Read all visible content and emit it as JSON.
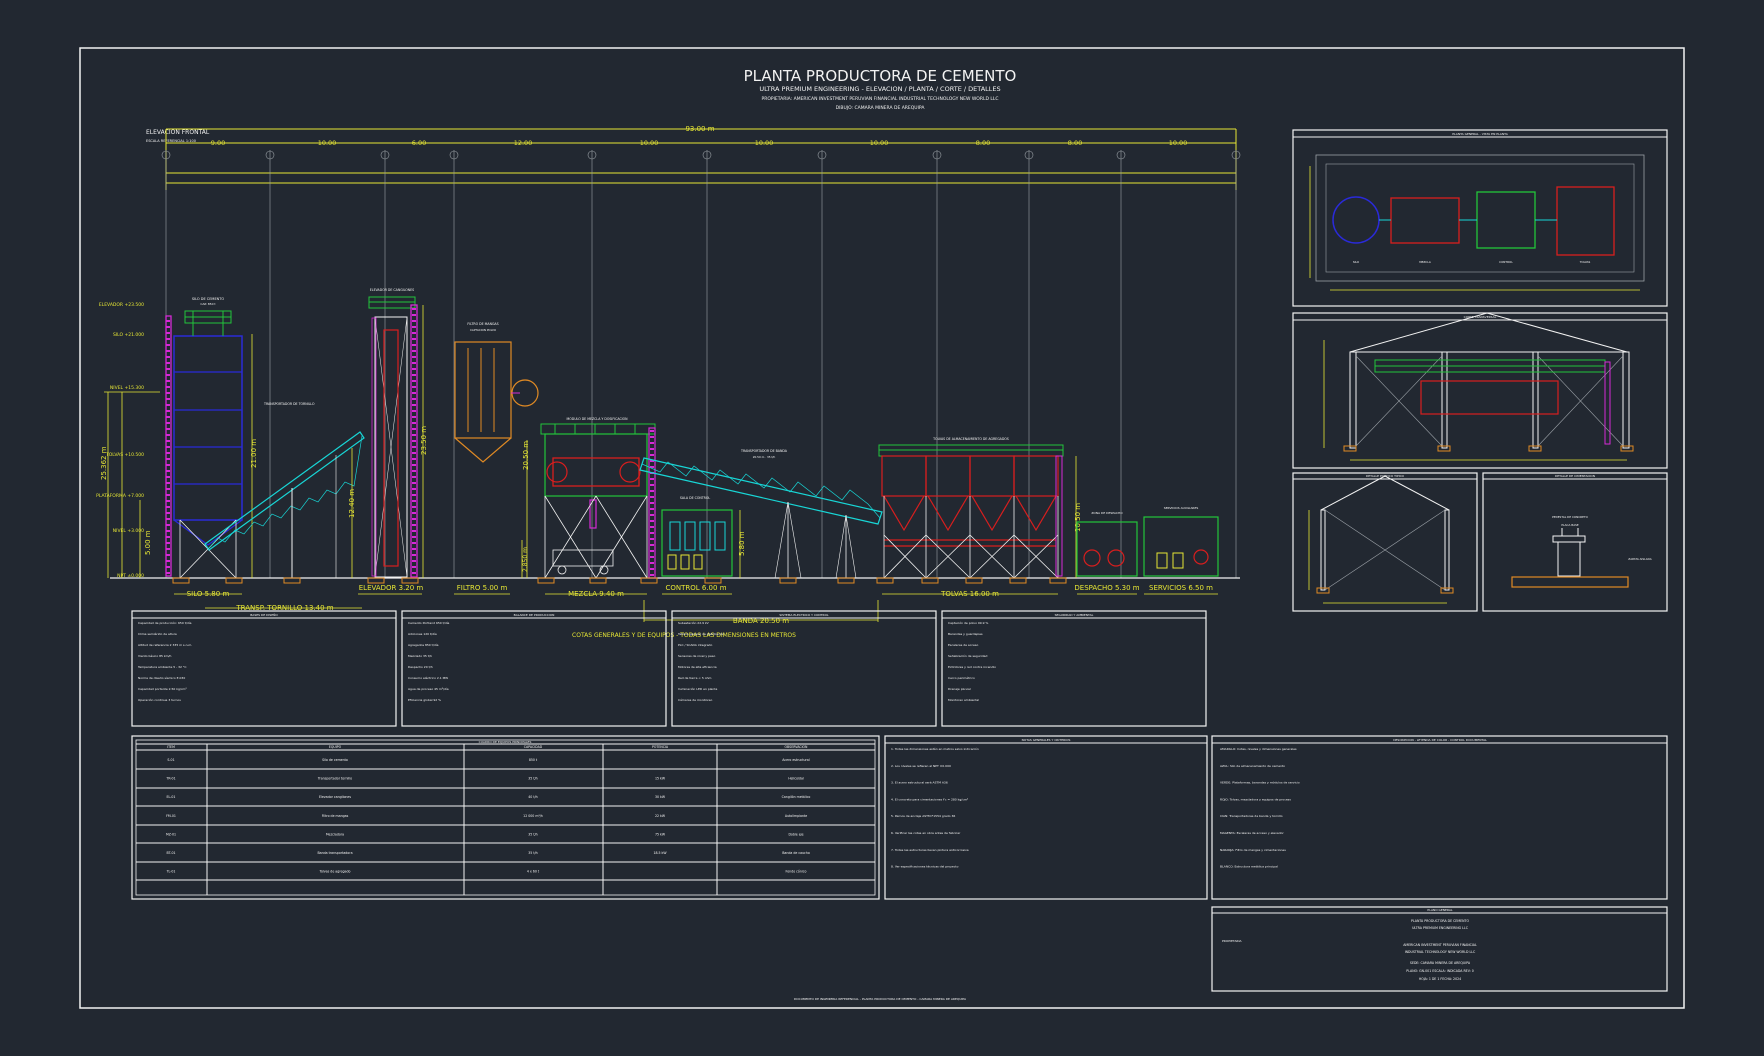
{
  "colors": {
    "bg": "#222831",
    "line": "#f2f2f2",
    "dim": "#e6e635",
    "blue": "#2a2ad8",
    "green": "#22c53a",
    "red": "#d81e1e",
    "cyan": "#18d6d6",
    "magenta": "#d62ad6",
    "orange": "#e08a24",
    "grey": "#9aa0a6"
  },
  "header": {
    "title": "PLANTA PRODUCTORA DE CEMENTO",
    "subtitle": "ULTRA PREMIUM ENGINEERING - ELEVACION / PLANTA / CORTE / DETALLES",
    "owner": "PROPIETARIA: AMERICAN INVESTMENT PERUVIAN FINANCIAL INDUSTRIAL TECHNOLOGY NEW WORLD LLC",
    "drawn": "DIBUJO: CAMARA MINERA DE AREQUIPA"
  },
  "elevation": {
    "label": "ELEVACION FRONTAL",
    "scale": "ESCALA REFERENCIAL 1:100",
    "total": "93.00 m",
    "spans": [
      "9.00",
      "10.00",
      "6.00",
      "12.00",
      "10.00",
      "10.00",
      "10.00",
      "8.00",
      "8.00",
      "10.00"
    ],
    "levels": [
      "ELEVADOR +23.500",
      "SILO +21.000",
      "NIVEL +15.300",
      "TOLVAS +10.500",
      "PLATAFORMA +7.000",
      "NIVEL +3.000",
      "NPT ±0.000"
    ],
    "vert_dims": {
      "silo": "21.00 m",
      "left_total": "25.362 m",
      "silo_base": "5.00 m",
      "tornillo": "12.40 m",
      "elevador": "23.50 m",
      "filtro": "20.50 m",
      "mezcla_base": "2.850 m",
      "control": "5.80 m",
      "tolvas": "10.50 m"
    },
    "callouts": {
      "silo": "SILO DE CEMENTO",
      "silo_cap": "CAP. 850 t",
      "tornillo": "TRANSPORTADOR DE TORNILLO",
      "elevador": "ELEVADOR DE CANGILONES",
      "filtro": "FILTRO DE MANGAS",
      "filtro_sub": "CAPTACION POLVO",
      "mezcla": "MODULO DE MEZCLA Y DOSIFICACION",
      "banda": "TRANSPORTADOR DE BANDA",
      "banda_sub": "20.50 m · 35 t/h",
      "control": "SALA DE CONTROL",
      "tolvas": "TOLVAS DE ALMACENAMIENTO DE AGREGADOS",
      "despacho": "ZONA DE DESPACHO",
      "servicios": "SERVICIOS AUXILIARES"
    },
    "footer_labels": [
      "SILO 5.80 m",
      "ELEVADOR 3.20 m",
      "FILTRO 5.00 m",
      "MEZCLA 9.40 m",
      "CONTROL 6.00 m",
      "TOLVAS 16.00 m",
      "DESPACHO 5.30 m",
      "SERVICIOS 6.50 m"
    ],
    "tornillo_label": "TRANSP. TORNILLO 13.40 m",
    "banda_label": "BANDA 20.50 m",
    "note": "COTAS GENERALES Y DE EQUIPOS - TODAS LAS DIMENSIONES EN METROS"
  },
  "side_views": {
    "plan": "PLANTA GENERAL - VISTA EN PLANTA",
    "plan_labels": [
      "SILO",
      "MEZCLA",
      "CONTROL",
      "TOLVAS"
    ],
    "section": "CORTE TRANSVERSAL",
    "detail_left": "DETALLE PORTICO TIPICO",
    "detail_right": "DETALLE DE CIMENTACION",
    "detail_right_sub": [
      "PEDESTAL DE CONCRETO",
      "PLACA BASE"
    ],
    "detail_right_note": "ZAPATA AISLADA"
  },
  "info_boxes": [
    {
      "title": "BASES DE DISEÑO",
      "lines": [
        "Capacidad de producción: 650 t/día",
        "Clima semiárido de altura",
        "Altitud de referencia 2 335 m s.n.m.",
        "Viento básico 85 km/h",
        "Temperatura ambiente 5 - 32 °C",
        "Norma de diseño sísmico E.030",
        "Capacidad portante 2.50 kg/cm²",
        "Operación continua 3 turnos"
      ]
    },
    {
      "title": "BALANCE DE PRODUCCION",
      "lines": [
        "Cemento Portland 650 t/día",
        "Adiciones 120 t/día",
        "Agregados 850 t/día",
        "Mezclado 35 t/h",
        "Despacho 20 t/h",
        "Consumo eléctrico 2.1 MW",
        "Agua de proceso 45 m³/día",
        "Eficiencia global 92 %"
      ]
    },
    {
      "title": "SISTEMA ELECTRICO Y CONTROL",
      "lines": [
        "Subestación 22.9 kV",
        "Tablero general de distribución",
        "PLC / SCADA integrado",
        "Sensores de nivel y peso",
        "Motores de alta eficiencia",
        "Red de tierra < 5 ohm",
        "Iluminación LED en planta",
        "Cámaras de monitoreo"
      ]
    },
    {
      "title": "SEGURIDAD Y AMBIENTAL",
      "lines": [
        "Captación de polvo 99.9 %",
        "Barandas y guardapies",
        "Escaleras de acceso",
        "Señalización de seguridad",
        "Extintores y red contra incendio",
        "Cerco perimétrico",
        "Drenaje pluvial",
        "Monitoreo ambiental"
      ]
    }
  ],
  "table": {
    "title": "CUADRO DE EQUIPOS PRINCIPALES",
    "headers": [
      "ITEM",
      "EQUIPO",
      "CAPACIDAD",
      "POTENCIA",
      "OBSERVACION"
    ],
    "rows": [
      [
        "S-01",
        "Silo de cemento",
        "850 t",
        "",
        "Acero estructural"
      ],
      [
        "TR-01",
        "Transportador tornillo",
        "35 t/h",
        "15 kW",
        "Helicoidal"
      ],
      [
        "EL-01",
        "Elevador cangilones",
        "40 t/h",
        "30 kW",
        "Cangilón metálico"
      ],
      [
        "FM-01",
        "Filtro de mangas",
        "12 000 m³/h",
        "22 kW",
        "Autolimpiante"
      ],
      [
        "MZ-01",
        "Mezcladora",
        "35 t/h",
        "75 kW",
        "Doble eje"
      ],
      [
        "BT-01",
        "Banda transportadora",
        "35 t/h",
        "18.5 kW",
        "Banda de caucho"
      ],
      [
        "TL-01",
        "Tolvas de agregado",
        "4 x 60 t",
        "",
        "Fondo cónico"
      ]
    ]
  },
  "notes": {
    "title": "NOTAS GENERALES Y CRITERIOS",
    "lines": [
      "1. Todas las dimensiones están en metros salvo indicación",
      "2. Los niveles se refieren al NPT ±0.000",
      "3. El acero estructural será ASTM A36",
      "4. El concreto para cimentaciones f'c = 280 kg/cm²",
      "5. Pernos de anclaje ASTM F1554 grado 36",
      "6. Verificar las cotas en obra antes de fabricar",
      "7. Todas las estructuras llevan pintura anticorrosiva",
      "8. Ver especificaciones técnicas del proyecto"
    ]
  },
  "legend": {
    "title": "DESCRIPCION - LEYENDA DE COLOR - CONTROL DOCUMENTAL",
    "lines": [
      "AMARILLO: Cotas, niveles y dimensiones generales",
      "AZUL: Silo de almacenamiento de cemento",
      "VERDE: Plataformas, barandas y módulos de servicio",
      "ROJO: Tolvas, mezcladora y equipos de proceso",
      "CIAN: Transportadores de banda y tornillo",
      "MAGENTA: Escaleras de acceso y elevador",
      "NARANJA: Filtro de mangas y cimentaciones",
      "BLANCO: Estructura metálica principal"
    ]
  },
  "title_block": {
    "header": "PLANO GENERAL",
    "lines": [
      "PLANTA PRODUCTORA DE CEMENTO",
      "ULTRA PREMIUM ENGINEERING LLC",
      "AMERICAN INVESTMENT PERUVIAN FINANCIAL",
      "INDUSTRIAL TECHNOLOGY NEW WORLD LLC",
      "SEDE: CAMARA MINERA DE AREQUIPA",
      "PLANO: GN-001   ESCALA: INDICADA   REV: 0",
      "HOJA: 1 DE 1   FECHA: 2024"
    ],
    "side": "PROPIETARIA"
  },
  "footer": "DOCUMENTO DE INGENIERIA REFERENCIAL - PLANTA PRODUCTORA DE CEMENTO - CAMARA MINERA DE AREQUIPA"
}
